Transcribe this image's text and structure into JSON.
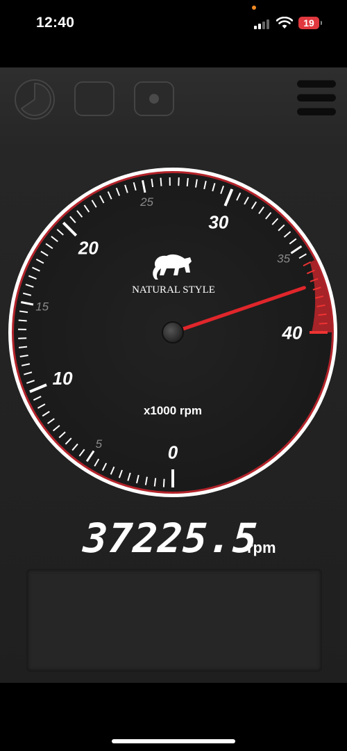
{
  "status_bar": {
    "time": "12:40",
    "battery_level": "19"
  },
  "toolbar": {
    "buttons": [
      "gauge-view",
      "display-mode",
      "record",
      "menu"
    ]
  },
  "gauge": {
    "brand": "NATURAL STYLE",
    "unit_label": "x1000 rpm",
    "min": 0,
    "max": 40,
    "major_labels": [
      "0",
      "10",
      "20",
      "30",
      "40"
    ],
    "minor_labels": [
      "5",
      "15",
      "25",
      "35"
    ],
    "redline_start": 36,
    "needle_value": 37.2255,
    "colors": {
      "ring": "#ffffff",
      "redline": "#c0262b",
      "needle": "#e0262b",
      "face": "#1f1f1f"
    }
  },
  "readout": {
    "value": "37225.5",
    "unit": "rpm"
  }
}
